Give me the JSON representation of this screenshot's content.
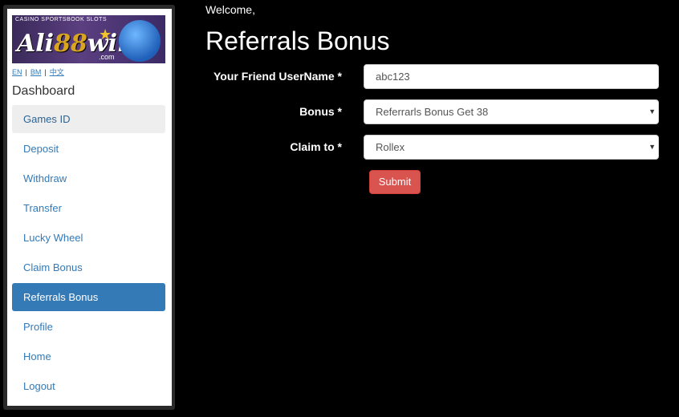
{
  "sidebar": {
    "logo": {
      "tagline": "CASINO  SPORTSBOOK  SLOTS",
      "brand_prefix": "Ali",
      "brand_number": "88",
      "brand_suffix": "win",
      "domain": ".com"
    },
    "languages": [
      "EN",
      "BM",
      "中文"
    ],
    "dashboard_title": "Dashboard",
    "items": [
      {
        "label": "Games ID"
      },
      {
        "label": "Deposit"
      },
      {
        "label": "Withdraw"
      },
      {
        "label": "Transfer"
      },
      {
        "label": "Lucky Wheel"
      },
      {
        "label": "Claim Bonus"
      },
      {
        "label": "Referrals Bonus"
      },
      {
        "label": "Profile"
      },
      {
        "label": "Home"
      },
      {
        "label": "Logout"
      }
    ]
  },
  "header": {
    "welcome": "Welcome,"
  },
  "main": {
    "title": "Referrals Bonus",
    "form": {
      "username_label": "Your Friend UserName *",
      "username_value": "abc123",
      "bonus_label": "Bonus *",
      "bonus_value": "Referrarls Bonus Get 38",
      "claim_label": "Claim to *",
      "claim_value": "Rollex",
      "submit_label": "Submit"
    }
  },
  "colors": {
    "active_nav": "#337ab7",
    "submit": "#d9534f",
    "background": "#000000"
  }
}
